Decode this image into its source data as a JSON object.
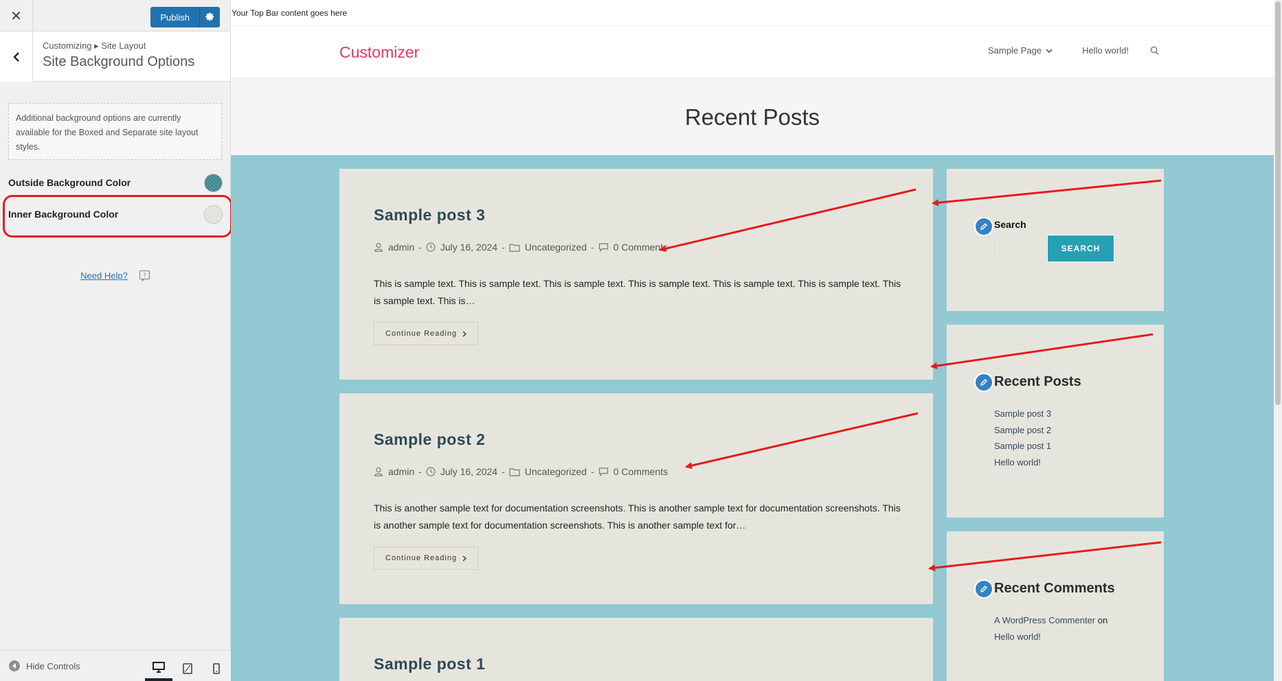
{
  "sidebar": {
    "publish_label": "Publish",
    "breadcrumb": "Customizing ▸ Site Layout",
    "section_title": "Site Background Options",
    "notice": "Additional background options are currently available for the Boxed and Separate site layout styles.",
    "controls": [
      {
        "label": "Outside Background Color",
        "swatch": "#4a8b98"
      },
      {
        "label": "Inner Background Color",
        "swatch": "#e6e5dd"
      }
    ],
    "help_label": "Need Help?",
    "hide_controls_label": "Hide Controls"
  },
  "preview": {
    "topbar_text": "Your Top Bar content goes here",
    "logo": "Customizer",
    "nav": [
      "Sample Page",
      "Hello world!"
    ],
    "page_title": "Recent Posts",
    "posts": [
      {
        "title": "Sample post 3",
        "author": "admin",
        "date": "July 16, 2024",
        "category": "Uncategorized",
        "comments": "0 Comments",
        "excerpt": "This is sample text. This is sample text. This is sample text. This is sample text. This is sample text. This is sample text. This is sample text. This is…",
        "read_more": "Continue Reading"
      },
      {
        "title": "Sample post 2",
        "author": "admin",
        "date": "July 16, 2024",
        "category": "Uncategorized",
        "comments": "0 Comments",
        "excerpt": "This is another sample text for documentation screenshots. This is another sample text for documentation screenshots. This is another sample text for documentation screenshots. This is another sample text for…",
        "read_more": "Continue Reading"
      },
      {
        "title": "Sample post 1"
      }
    ],
    "widgets": {
      "search": {
        "label": "Search",
        "button": "SEARCH"
      },
      "recent_posts": {
        "title": "Recent Posts",
        "items": [
          "Sample post 3",
          "Sample post 2",
          "Sample post 1",
          "Hello world!"
        ]
      },
      "recent_comments": {
        "title": "Recent Comments",
        "author": "A WordPress Commenter",
        "on": "on",
        "post": "Hello world!"
      }
    }
  },
  "colors": {
    "outer_background": "#92c9d3",
    "inner_background": "#e6e5dd",
    "highlight": "#e51b1b",
    "accent": "#2271b1",
    "logo": "#e3395f",
    "search_button": "#26a0b3"
  }
}
